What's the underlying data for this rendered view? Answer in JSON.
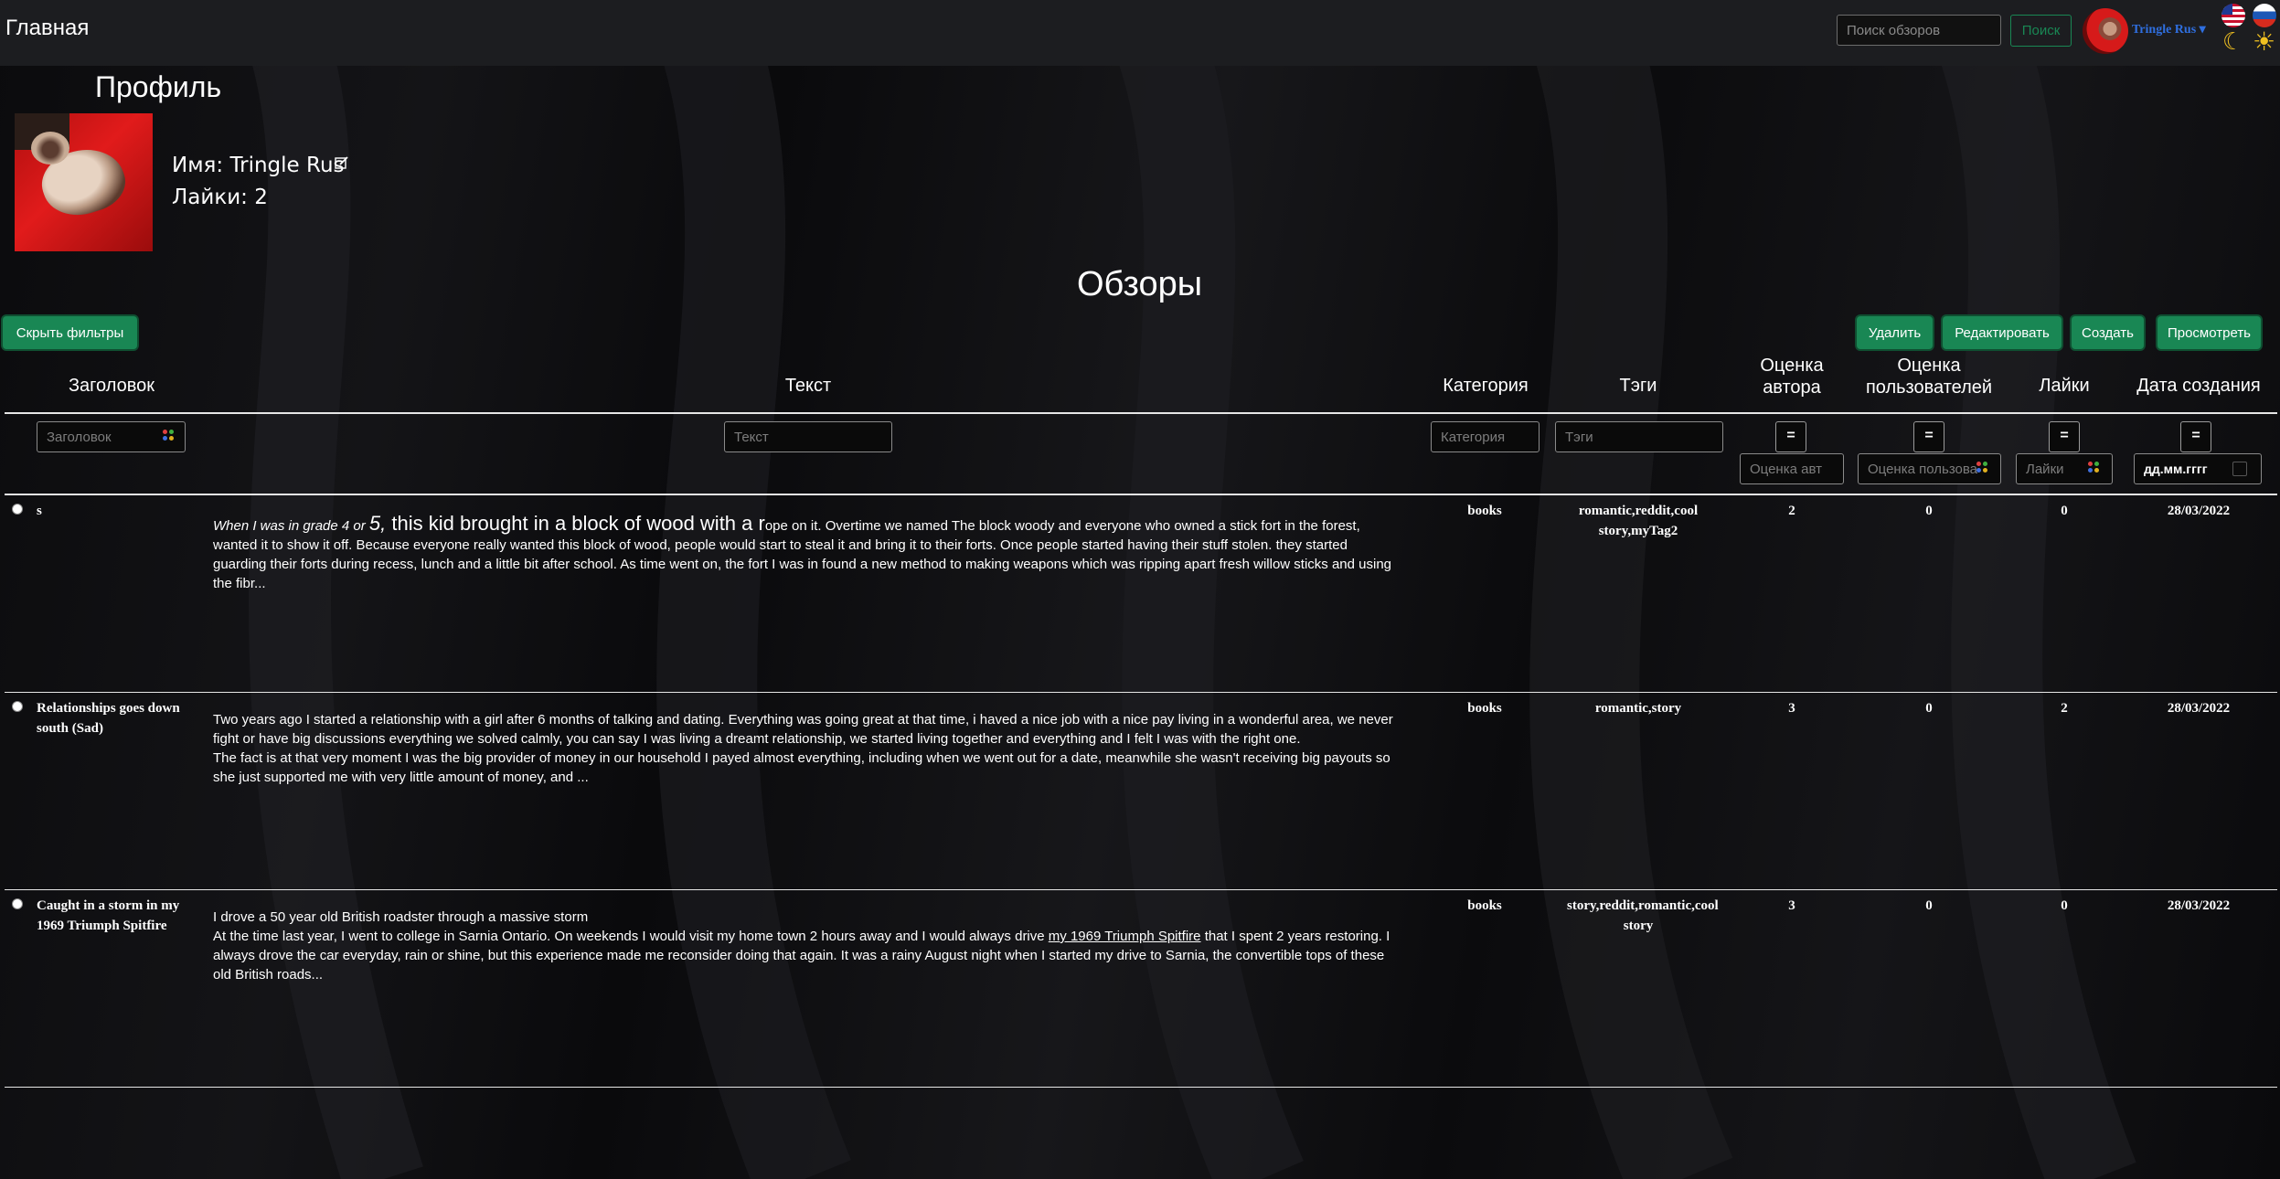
{
  "navbar": {
    "brand": "Главная",
    "search_placeholder": "Поиск обзоров",
    "search_button": "Поиск",
    "user_name": "Tringle Rus",
    "user_caret": "▾"
  },
  "profile": {
    "title": "Профиль",
    "name_line": "Имя: Tringle Rus",
    "likes_line": "Лайки: 2"
  },
  "reviews": {
    "title": "Обзоры",
    "hide_filters": "Скрыть фильтры",
    "actions": {
      "delete": "Удалить",
      "edit": "Редактировать",
      "create": "Создать",
      "view": "Просмотреть"
    },
    "columns": {
      "title": "Заголовок",
      "text": "Текст",
      "category": "Категория",
      "tags": "Тэги",
      "author_rating_1": "Оценка",
      "author_rating_2": "автора",
      "user_rating_1": "Оценка",
      "user_rating_2": "пользователей",
      "likes": "Лайки",
      "date": "Дата создания"
    },
    "filters": {
      "title_ph": "Заголовок",
      "text_ph": "Текст",
      "category_ph": "Категория",
      "tags_ph": "Тэги",
      "author_ph": "Оценка авт",
      "users_ph": "Оценка пользова",
      "likes_ph": "Лайки",
      "eq": "=",
      "date_value": "дд.мм.гггг"
    },
    "rows": [
      {
        "title": "s",
        "text_it": "When I was in grade 4 or ",
        "text_big_it": "5,",
        "text_big": " this kid brought in a block of wood with a r",
        "text_rest": "ope on it. Overtime we named The block woody and everyone who owned a stick fort in the forest, wanted it to show it off. Because everyone really wanted this block of wood, people would start to steal it and bring it to their forts. Once people started having their stuff stolen. they started guarding their forts during recess, lunch and a little bit after school. As time went on, the fort I was in found a new method to making weapons which was ripping apart fresh willow sticks and using the fibr...",
        "category": "books",
        "tags": "romantic,reddit,cool story,myTag2",
        "author_rating": "2",
        "user_rating": "0",
        "likes": "0",
        "date": "28/03/2022"
      },
      {
        "title": "Relationships goes down south (Sad)",
        "text_p1": "Two years ago I started a relationship with a girl after 6 months of talking and dating. Everything was going great at that time, i haved a nice job with a nice pay living in a wonderful area, we never fight or have big discussions everything we solved calmly, you can say I was living a dreamt relationship, we started living together and everything and I felt I was with the right one.",
        "text_p2": "The fact is at that very moment I was the big provider of money in our household I payed almost everything, including when we went out for a date, meanwhile she wasn't receiving big payouts so she just supported me with very little amount of money, and ...",
        "category": "books",
        "tags": "romantic,story",
        "author_rating": "3",
        "user_rating": "0",
        "likes": "2",
        "date": "28/03/2022"
      },
      {
        "title": "Caught in a storm in my 1969 Triumph Spitfire",
        "text_p1": "I drove a 50 year old British roadster through a massive storm",
        "text_p2a": "At the time last year, I went to college in Sarnia Ontario. On weekends I would visit my home town 2 hours away and I would always drive ",
        "text_link": "my 1969 Triumph Spitfire",
        "text_p2b": " that I spent 2 years restoring. I always drove the car everyday, rain or shine, but this experience made me reconsider doing that again. It was a rainy August night when I started my drive to Sarnia, the convertible tops of these old British roads...",
        "category": "books",
        "tags": "story,reddit,romantic,cool story",
        "author_rating": "3",
        "user_rating": "0",
        "likes": "0",
        "date": "28/03/2022"
      }
    ]
  },
  "colors": {
    "accent_green": "#198754",
    "link_blue": "#2f6fe0",
    "navbar_bg": "#1c1d20"
  }
}
